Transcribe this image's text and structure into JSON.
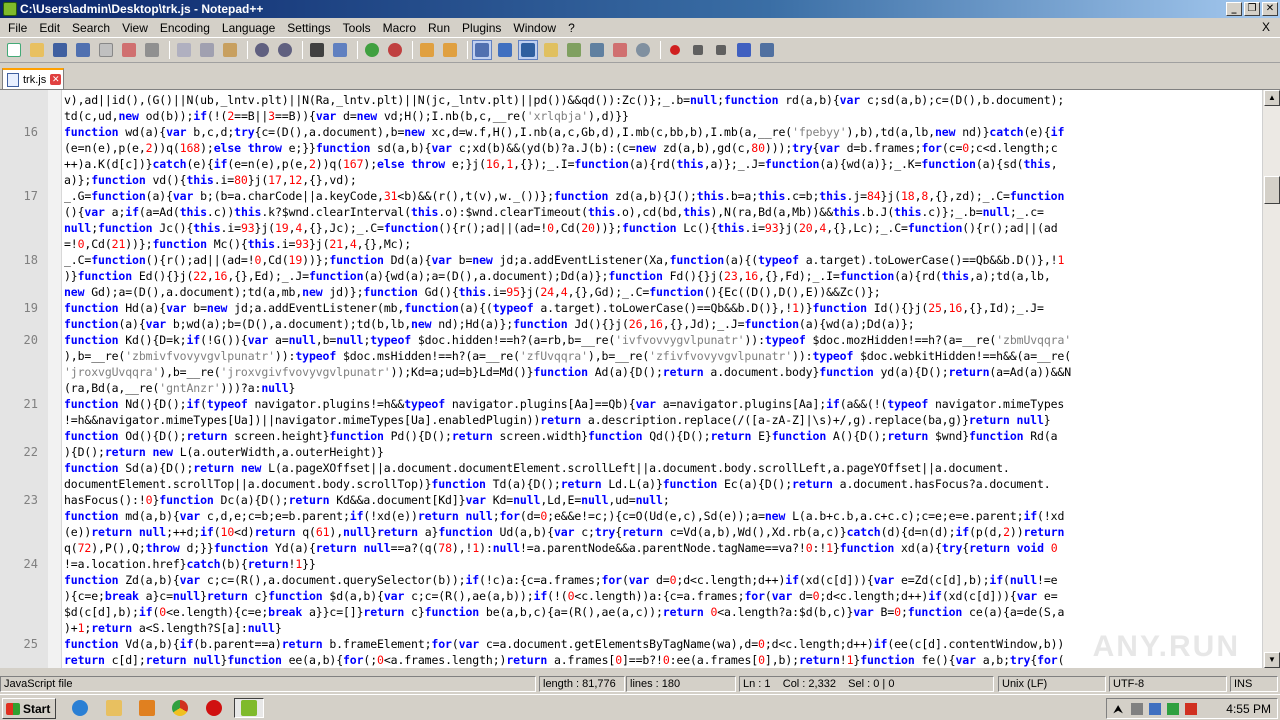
{
  "window": {
    "title": "C:\\Users\\admin\\Desktop\\trk.js - Notepad++",
    "buttons": [
      "_",
      "❐",
      "✕"
    ]
  },
  "menu": [
    "File",
    "Edit",
    "Search",
    "View",
    "Encoding",
    "Language",
    "Settings",
    "Tools",
    "Macro",
    "Run",
    "Plugins",
    "Window",
    "?"
  ],
  "menu_close": "X",
  "tab": {
    "label": "trk.js",
    "close": "✕"
  },
  "editor": {
    "line_numbers": [
      {
        "num": "",
        "row": 0
      },
      {
        "num": "16",
        "row": 2
      },
      {
        "num": "17",
        "row": 6
      },
      {
        "num": "18",
        "row": 10
      },
      {
        "num": "19",
        "row": 13
      },
      {
        "num": "20",
        "row": 15
      },
      {
        "num": "21",
        "row": 19
      },
      {
        "num": "22",
        "row": 22
      },
      {
        "num": "23",
        "row": 25
      },
      {
        "num": "24",
        "row": 29
      },
      {
        "num": "25",
        "row": 34
      }
    ],
    "lines": [
      "v),ad||id(),(G()||N(ub,_lntv.plt)||N(Ra,_lntv.plt)||N(jc,_lntv.plt)||pd())&&qd()):Zc()};_.b=null;function rd(a,b){var c;sd(a,b);c=(D(),b.document);",
      "td(c,ud,new od(b));if(!(2==B||3==B)){var d=new vd;H();I.nb(b,c,__re('xrlqbja'),d)}}",
      "function wd(a){var b,c,d;try{c=(D(),a.document),b=new xc,d=w.f,H(),I.nb(a,c,Gb,d),I.mb(c,bb,b),I.mb(a,__re('fpebyy'),b),td(a,lb,new nd)}catch(e){if",
      "(e=n(e),p(e,2))q(168);else throw e;}}function sd(a,b){var c;xd(b)&&(yd(b)?a.J(b):(c=new zd(a,b),gd(c,80)));try{var d=b.frames;for(c=0;c<d.length;c",
      "++)a.K(d[c])}catch(e){if(e=n(e),p(e,2))q(167);else throw e;}j(16,1,{});_.I=function(a){rd(this,a)};_.J=function(a){wd(a)};_.K=function(a){sd(this,",
      "a)};function vd(){this.i=80}j(17,12,{},vd);",
      "_.G=function(a){var b;(b=a.charCode||a.keyCode,31<b)&&(r(),t(v),w._())};function zd(a,b){J();this.b=a;this.c=b;this.j=84}j(18,8,{},zd);_.C=function",
      "(){var a;if(a=Ad(this.c))this.k?$wnd.clearInterval(this.o):$wnd.clearTimeout(this.o),cd(bd,this),N(ra,Bd(a,Mb))&&this.b.J(this.c)};_.b=null;_.c=",
      "null;function Jc(){this.i=93}j(19,4,{},Jc);_.C=function(){r();ad||(ad=!0,Cd(20))};function Lc(){this.i=93}j(20,4,{},Lc);_.C=function(){r();ad||(ad",
      "=!0,Cd(21))};function Mc(){this.i=93}j(21,4,{},Mc);",
      "_.C=function(){r();ad||(ad=!0,Cd(19))};function Dd(a){var b=new jd;a.addEventListener(Xa,function(a){(typeof a.target).toLowerCase()==Qb&&b.D()},!1",
      ")}function Ed(){}j(22,16,{},Ed);_.J=function(a){wd(a);a=(D(),a.document);Dd(a)};function Fd(){}j(23,16,{},Fd);_.I=function(a){rd(this,a);td(a,lb,",
      "new Gd);a=(D(),a.document);td(a,mb,new jd)};function Gd(){this.i=95}j(24,4,{},Gd);_.C=function(){Ec((D(),D(),E))&&Zc()};",
      "function Hd(a){var b=new jd;a.addEventListener(mb,function(a){(typeof a.target).toLowerCase()==Qb&&b.D()},!1)}function Id(){}j(25,16,{},Id);_.J=",
      "function(a){var b;wd(a);b=(D(),a.document);td(b,lb,new nd);Hd(a)};function Jd(){}j(26,16,{},Jd);_.J=function(a){wd(a);Dd(a)};",
      "function Kd(){D=k;if(!G()){var a=null,b=null;typeof $doc.hidden!==h?(a=rb,b=__re('ivfvovvygvlpunatr')):typeof $doc.mozHidden!==h?(a=__re('zbmUvqqra'",
      "),b=__re('zbmivfvovyvgvlpunatr')):typeof $doc.msHidden!==h?(a=__re('zfUvqqra'),b=__re('zfivfvovyvgvlpunatr')):typeof $doc.webkitHidden!==h&&(a=__re(",
      "'jroxvgUvqqra'),b=__re('jroxvgivfvovyvgvlpunatr'));Kd=a;ud=b}Ld=Md()}function Ad(a){D();return a.document.body}function yd(a){D();return(a=Ad(a))&&N",
      "(ra,Bd(a,__re('gntAnzr')))?a:null}",
      "function Nd(){D();if(typeof navigator.plugins!=h&&typeof navigator.plugins[Aa]==Qb){var a=navigator.plugins[Aa];if(a&&(!(typeof navigator.mimeTypes",
      "!=h&&navigator.mimeTypes[Ua])||navigator.mimeTypes[Ua].enabledPlugin))return a.description.replace(/([a-zA-Z]|\\s)+/,g).replace(ba,g)}return null}",
      "function Od(){D();return screen.height}function Pd(){D();return screen.width}function Qd(){D();return E}function A(){D();return $wnd}function Rd(a",
      "){D();return new L(a.outerWidth,a.outerHeight)}",
      "function Sd(a){D();return new L(a.pageXOffset||a.document.documentElement.scrollLeft||a.document.body.scrollLeft,a.pageYOffset||a.document.",
      "documentElement.scrollTop||a.document.body.scrollTop)}function Td(a){D();return Ld.L(a)}function Ec(a){D();return a.document.hasFocus?a.document.",
      "hasFocus():!0}function Dc(a){D();return Kd&&a.document[Kd]}var Kd=null,Ld,E=null,ud=null;",
      "function md(a,b){var c,d,e;c=b;e=b.parent;if(!xd(e))return null;for(d=0;e&&e!=c;){c=O(Ud(e,c),Sd(e));a=new L(a.b+c.b,a.c+c.c);c=e;e=e.parent;if(!xd",
      "(e))return null;++d;if(10<d)return q(61),null}return a}function Ud(a,b){var c;try{return c=Vd(a,b),Wd(),Xd.rb(a,c)}catch(d){d=n(d);if(p(d,2))return",
      " q(72),P(),Q;throw d;}}function Yd(a){return null==a?(q(78),!1):null!=a.parentNode&&a.parentNode.tagName==va?!0:!1}function xd(a){try{return void 0",
      "!=a.location.href}catch(b){return!1}}",
      "function Zd(a,b){var c;c=(R(),a.document.querySelector(b));if(!c)a:{c=a.frames;for(var d=0;d<c.length;d++)if(xd(c[d])){var e=Zd(c[d],b);if(null!=e",
      "){c=e;break a}c=null}return c}function $d(a,b){var c;c=(R(),ae(a,b));if(!(0<c.length))a:{c=a.frames;for(var d=0;d<c.length;d++)if(xd(c[d])){var e=",
      "$d(c[d],b);if(0<e.length){c=e;break a}}c=[]}return c}function be(a,b,c){a=(R(),ae(a,c));return 0<a.length?a:$d(b,c)}var B=0;function ce(a){a=de(S,a",
      ")+1;return a<S.length?S[a]:null}",
      "function Vd(a,b){if(b.parent==a)return b.frameElement;for(var c=a.document.getElementsByTagName(wa),d=0;d<c.length;d++)if(ee(c[d].contentWindow,b))",
      "return c[d];return null}function ee(a,b){for(;0<a.frames.length;)return a.frames[0]==b?!0:ee(a.frames[0],b);return!1}function fe(){var a,b;try{for("
    ],
    "watermark": "ANY.RUN"
  },
  "status": {
    "language": "JavaScript file",
    "length": "length : 81,776",
    "lines": "lines : 180",
    "position": "Ln : 1    Col : 2,332    Sel : 0 | 0",
    "eol": "Unix (LF)",
    "encoding": "UTF-8",
    "mode": "INS"
  },
  "taskbar": {
    "start": "Start",
    "clock": "4:55 PM"
  },
  "colors": {
    "keyword": "#0000ff",
    "string": "#808080",
    "number": "#ff0000",
    "title_bar": "#0a246a"
  }
}
